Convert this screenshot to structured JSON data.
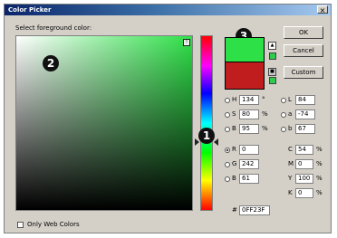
{
  "window": {
    "title": "Color Picker",
    "close_glyph": "×"
  },
  "prompt": "Select foreground color:",
  "buttons": {
    "ok": "OK",
    "cancel": "Cancel",
    "custom": "Custom"
  },
  "badges": {
    "one": "1",
    "two": "2",
    "three": "3"
  },
  "colors": {
    "new": "#2ee048",
    "old": "#c01e1e"
  },
  "icons": {
    "gamut_warning": "warning-triangle-icon",
    "websafe": "cube-icon"
  },
  "fields": {
    "H": {
      "label": "H",
      "value": "134",
      "unit": "°"
    },
    "S": {
      "label": "S",
      "value": "80",
      "unit": "%"
    },
    "B": {
      "label": "B",
      "value": "95",
      "unit": "%"
    },
    "R": {
      "label": "R",
      "value": "0",
      "unit": ""
    },
    "G": {
      "label": "G",
      "value": "242",
      "unit": ""
    },
    "Bl": {
      "label": "B",
      "value": "61",
      "unit": ""
    },
    "L": {
      "label": "L",
      "value": "84",
      "unit": ""
    },
    "a": {
      "label": "a",
      "value": "-74",
      "unit": ""
    },
    "b": {
      "label": "b",
      "value": "67",
      "unit": ""
    },
    "C": {
      "label": "C",
      "value": "54",
      "unit": "%"
    },
    "M": {
      "label": "M",
      "value": "0",
      "unit": "%"
    },
    "Y": {
      "label": "Y",
      "value": "100",
      "unit": "%"
    },
    "K": {
      "label": "K",
      "value": "0",
      "unit": "%"
    },
    "hex": {
      "label": "#",
      "value": "0FF23F"
    }
  },
  "web_colors_label": "Only Web Colors"
}
